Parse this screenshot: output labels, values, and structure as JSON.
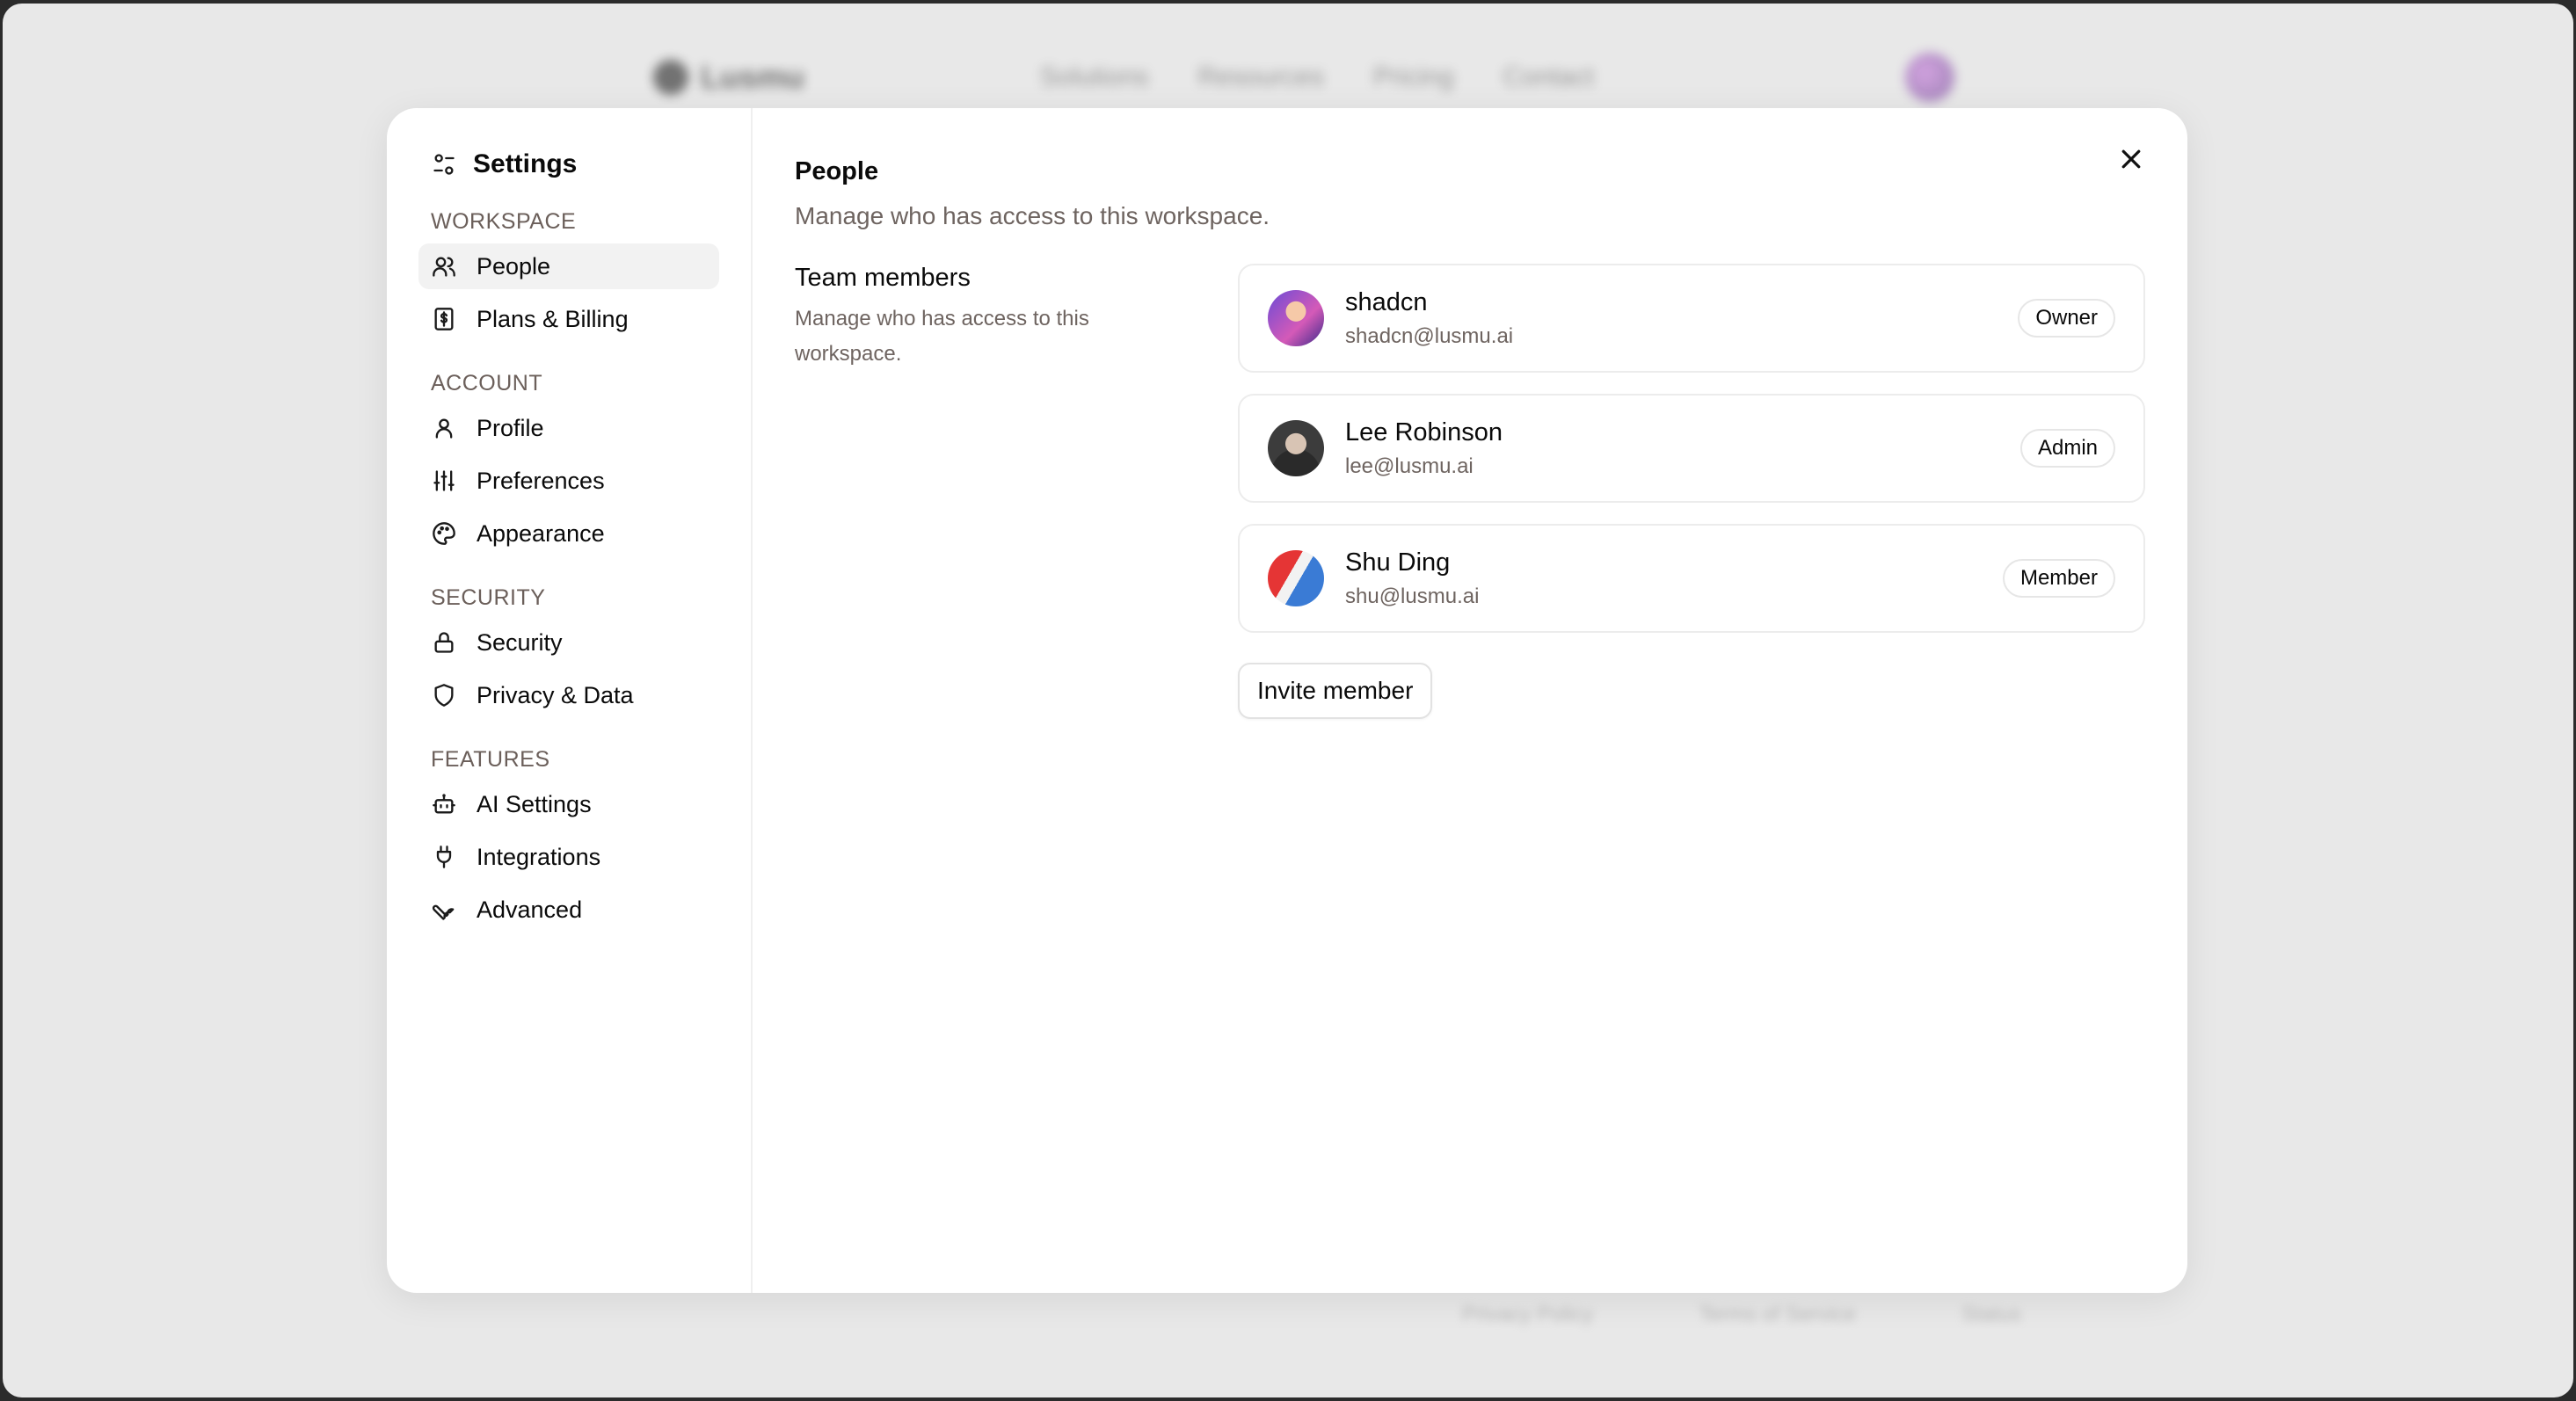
{
  "background": {
    "logo_text": "Lusmu",
    "nav_links": [
      "Solutions",
      "Resources",
      "Pricing",
      "Contact"
    ],
    "footer_links": [
      "Privacy Policy",
      "Terms of Service",
      "Status"
    ]
  },
  "settings": {
    "title": "Settings",
    "sections": [
      {
        "title": "WORKSPACE",
        "items": [
          {
            "label": "People",
            "icon": "users-icon",
            "active": true
          },
          {
            "label": "Plans & Billing",
            "icon": "dollar-icon"
          }
        ]
      },
      {
        "title": "ACCOUNT",
        "items": [
          {
            "label": "Profile",
            "icon": "user-icon"
          },
          {
            "label": "Preferences",
            "icon": "sliders-icon"
          },
          {
            "label": "Appearance",
            "icon": "palette-icon"
          }
        ]
      },
      {
        "title": "SECURITY",
        "items": [
          {
            "label": "Security",
            "icon": "lock-icon"
          },
          {
            "label": "Privacy & Data",
            "icon": "shield-icon"
          }
        ]
      },
      {
        "title": "FEATURES",
        "items": [
          {
            "label": "AI Settings",
            "icon": "bot-icon"
          },
          {
            "label": "Integrations",
            "icon": "plug-icon"
          },
          {
            "label": "Advanced",
            "icon": "wrench-icon"
          }
        ]
      }
    ]
  },
  "main": {
    "title": "People",
    "subtitle": "Manage who has access to this workspace.",
    "team": {
      "heading": "Team members",
      "description": "Manage who has access to this workspace."
    },
    "members": [
      {
        "name": "shadcn",
        "email": "shadcn@lusmu.ai",
        "role": "Owner"
      },
      {
        "name": "Lee Robinson",
        "email": "lee@lusmu.ai",
        "role": "Admin"
      },
      {
        "name": "Shu Ding",
        "email": "shu@lusmu.ai",
        "role": "Member"
      }
    ],
    "invite_label": "Invite member"
  }
}
